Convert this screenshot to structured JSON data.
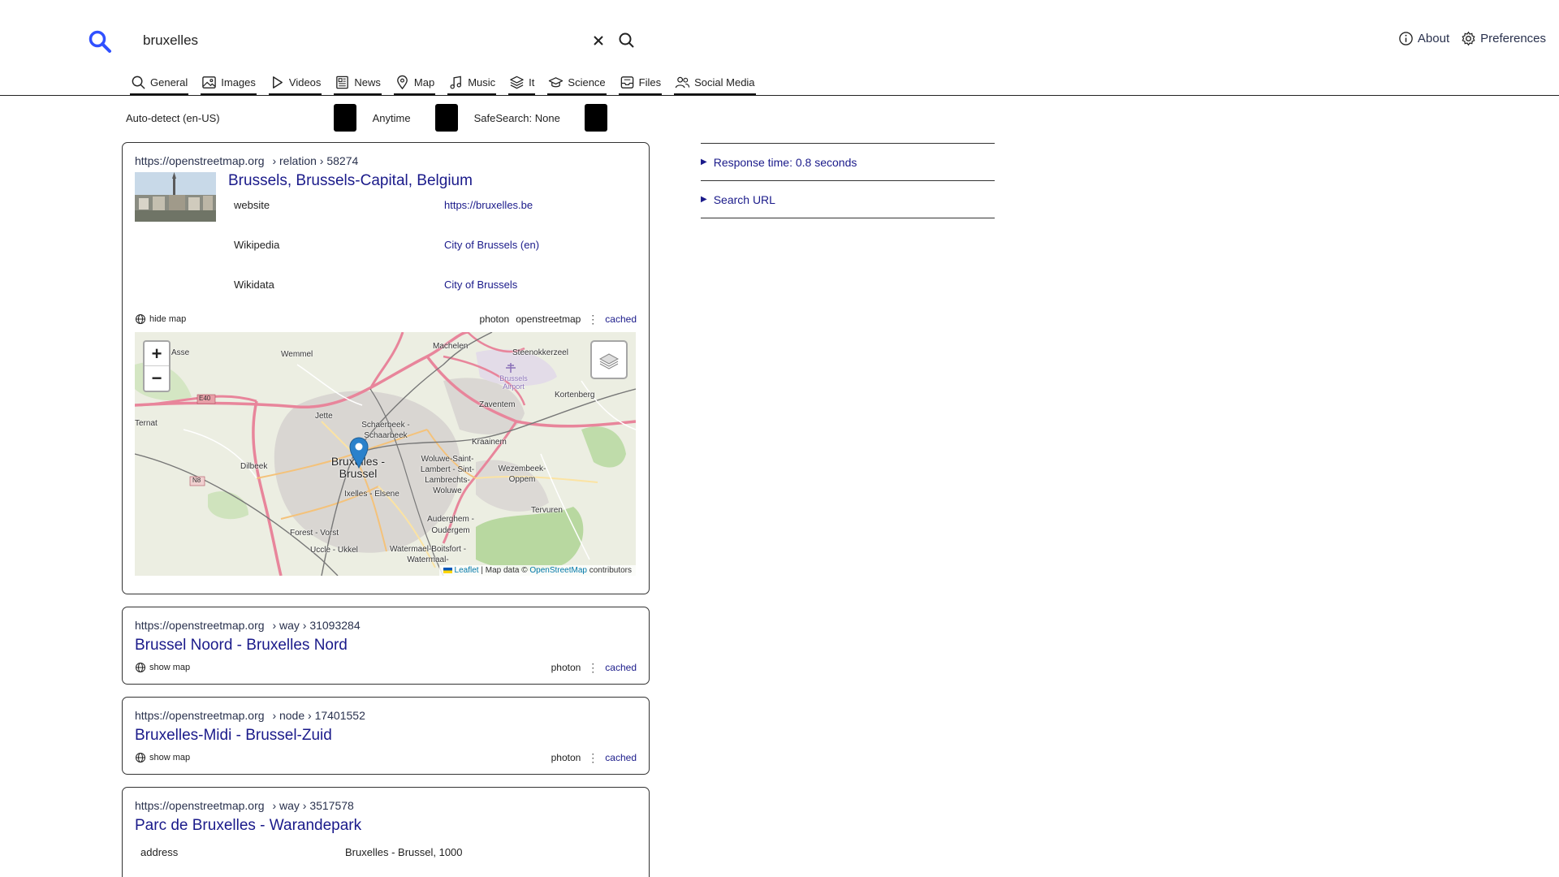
{
  "search": {
    "query": "bruxelles"
  },
  "top_links": [
    {
      "label": "About",
      "icon": "info-icon"
    },
    {
      "label": "Preferences",
      "icon": "gear-icon"
    }
  ],
  "tabs": [
    {
      "label": "General",
      "icon": "search-icon"
    },
    {
      "label": "Images",
      "icon": "image-icon"
    },
    {
      "label": "Videos",
      "icon": "play-icon"
    },
    {
      "label": "News",
      "icon": "newspaper-icon"
    },
    {
      "label": "Map",
      "icon": "map-pin-icon"
    },
    {
      "label": "Music",
      "icon": "music-icon"
    },
    {
      "label": "It",
      "icon": "layers-icon"
    },
    {
      "label": "Science",
      "icon": "graduation-icon"
    },
    {
      "label": "Files",
      "icon": "inbox-icon"
    },
    {
      "label": "Social Media",
      "icon": "people-icon"
    }
  ],
  "filters": {
    "language": "Auto-detect (en-US)",
    "time": "Anytime",
    "safesearch": "SafeSearch: None"
  },
  "results": [
    {
      "domain": "https://openstreetmap.org",
      "path": "› relation › 58274",
      "title": "Brussels, Brussels-Capital, Belgium",
      "fields": [
        {
          "key": "website",
          "value": "https://bruxelles.be"
        },
        {
          "key": "Wikipedia",
          "value": "City of Brussels (en)"
        },
        {
          "key": "Wikidata",
          "value": "City of Brussels"
        }
      ],
      "map_toggle": "hide map",
      "engines": [
        "photon",
        "openstreetmap"
      ],
      "cached": "cached"
    },
    {
      "domain": "https://openstreetmap.org",
      "path": "› way › 31093284",
      "title": "Brussel Noord - Bruxelles Nord",
      "map_toggle": "show map",
      "engines": [
        "photon"
      ],
      "cached": "cached"
    },
    {
      "domain": "https://openstreetmap.org",
      "path": "› node › 17401552",
      "title": "Bruxelles-Midi - Brussel-Zuid",
      "map_toggle": "show map",
      "engines": [
        "photon"
      ],
      "cached": "cached"
    },
    {
      "domain": "https://openstreetmap.org",
      "path": "› way › 3517578",
      "title": "Parc de Bruxelles - Warandepark",
      "fields": [
        {
          "key": "address",
          "value": "Bruxelles - Brussel, 1000"
        }
      ]
    }
  ],
  "map": {
    "zoom_in": "+",
    "zoom_out": "−",
    "attribution": {
      "leaflet": "Leaflet",
      "middle": " | Map data © ",
      "osm": "OpenStreetMap",
      "suffix": " contributors"
    },
    "labels": {
      "asse": "Asse",
      "wemmel": "Wemmel",
      "machelen": "Machelen",
      "steenokkerzeel": "Steenokkerzeel",
      "airport": "Brussels Airport",
      "kortenberg": "Kortenberg",
      "zaventem": "Zaventem",
      "ternat": "Ternat",
      "jette": "Jette",
      "schaerbeek": "Schaerbeek - Schaarbeek",
      "kraainem": "Kraainem",
      "dilbeek": "Dilbeek",
      "brussel": "Bruxelles - Brussel",
      "woluwe_lambert": "Woluwe-Saint-Lambert - Sint-Lambrechts-Woluwe",
      "wezembeek": "Wezembeek-Oppem",
      "ixelles": "Ixelles - Elsene",
      "tervuren": "Tervuren",
      "auderghem": "Auderghem - Oudergem",
      "forest": "Forest - Vorst",
      "uccle": "Uccle - Ukkel",
      "watermael": "Watermael-Boitsfort - Watermaal-",
      "e40": "E40",
      "n8": "N8"
    }
  },
  "sidebar": {
    "response_time": "Response time: 0.8 seconds",
    "search_url": "Search URL"
  },
  "colors": {
    "link": "#1a1a8a",
    "accent": "#3050ff",
    "pin": "#2a81cb"
  }
}
